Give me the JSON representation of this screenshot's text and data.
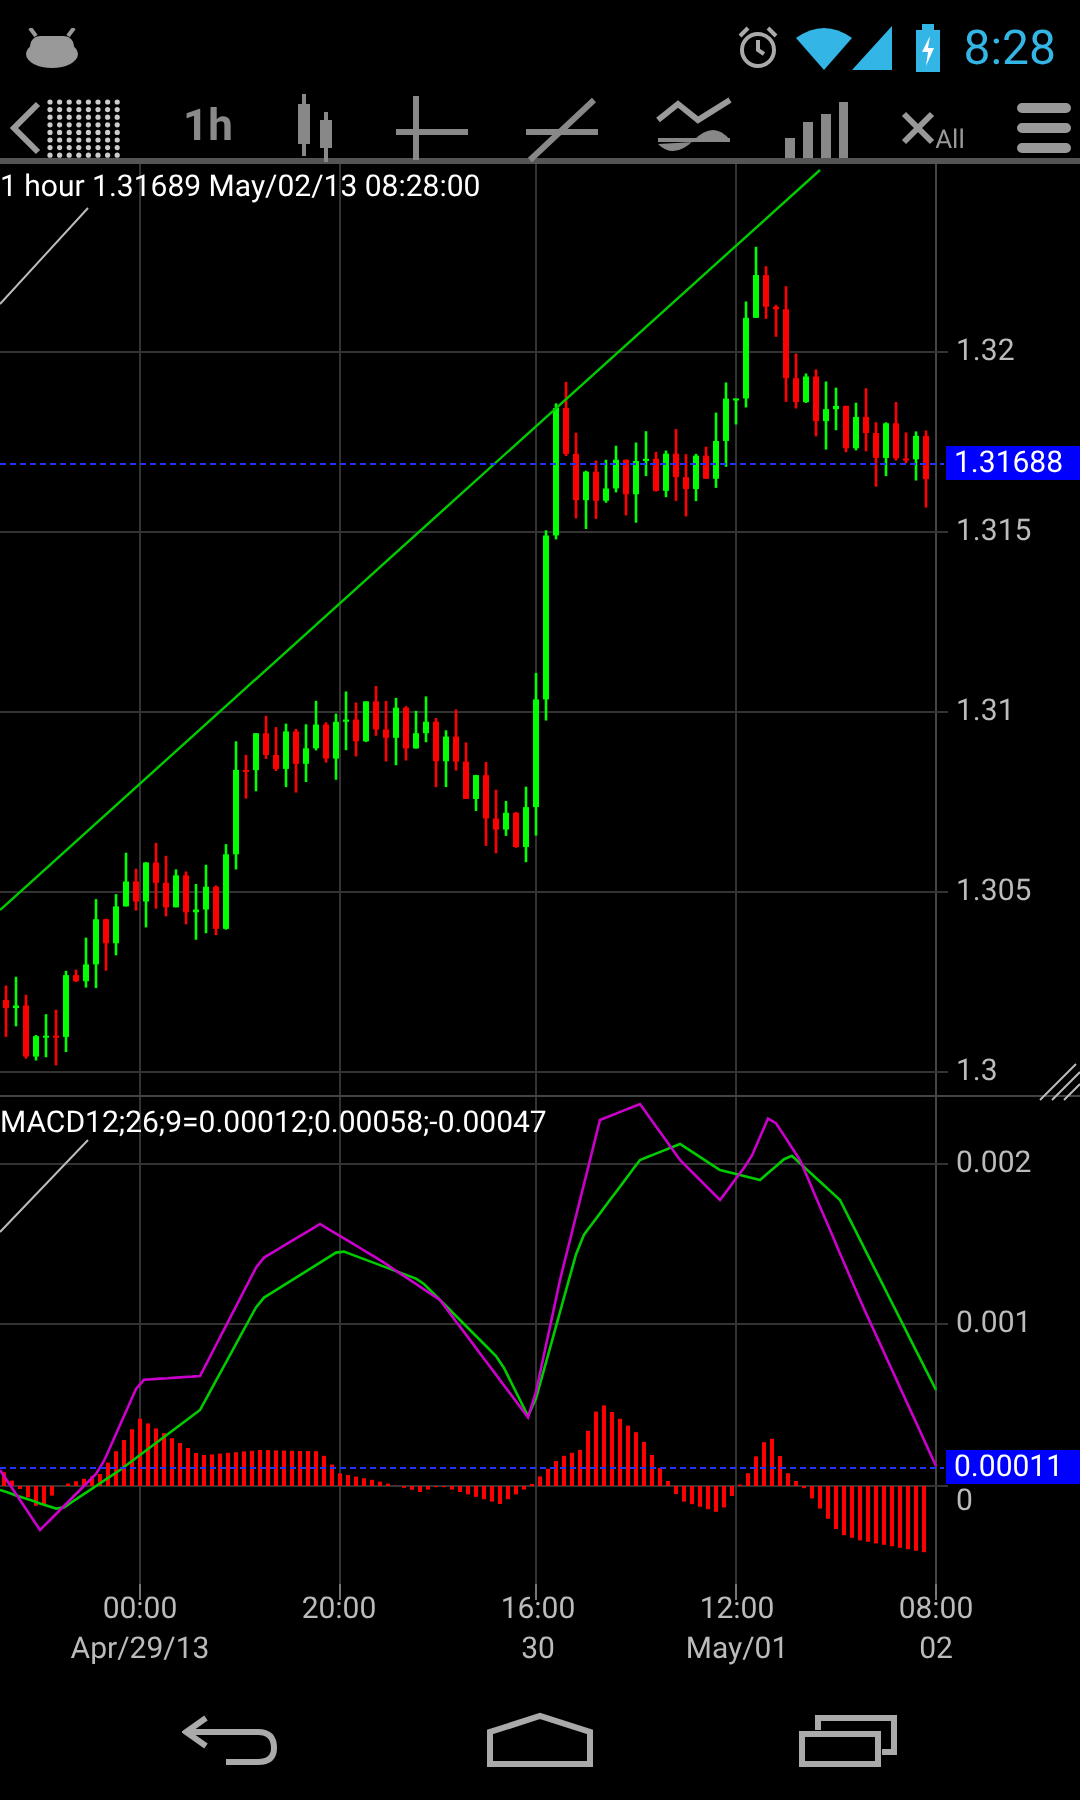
{
  "status_bar": {
    "time": "8:28"
  },
  "toolbar": {
    "timeframe": "1h",
    "clear_label": "All"
  },
  "price_chart": {
    "legend": "1 hour 1.31689 May/02/13 08:28:00",
    "y_ticks": [
      "1.32",
      "1.315",
      "1.31",
      "1.305",
      "1.3"
    ],
    "current_price": "1.31688"
  },
  "macd_chart": {
    "legend": "MACD12;26;9=0.00012;0.00058;-0.00047",
    "y_ticks": [
      "0.002",
      "0.001",
      "0"
    ],
    "current_value": "0.00011"
  },
  "time_axis": [
    {
      "time": "00:00",
      "date": "Apr/29/13"
    },
    {
      "time": "20:00"
    },
    {
      "time": "16:00",
      "date": "30"
    },
    {
      "time": "12:00",
      "date": "May/01"
    },
    {
      "time": "08:00",
      "date": "02"
    }
  ]
}
